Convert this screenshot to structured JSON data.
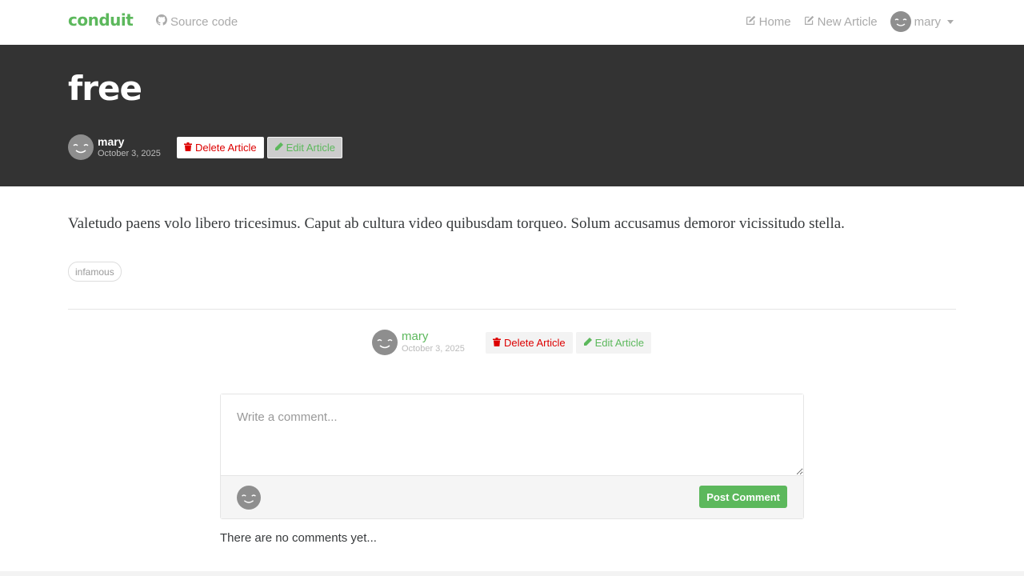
{
  "navbar": {
    "brand": "conduit",
    "source_code": "Source code",
    "home": "Home",
    "new_article": "New Article",
    "username": "mary"
  },
  "article": {
    "title": "free",
    "author": "mary",
    "date": "October 3, 2025",
    "body": "Valetudo paens volo libero tricesimus. Caput ab cultura video quibusdam torqueo. Solum accusamus demoror vicissitudo stella.",
    "tags": [
      "infamous"
    ],
    "delete_label": "Delete Article",
    "edit_label": "Edit Article"
  },
  "comments": {
    "placeholder": "Write a comment...",
    "post_label": "Post Comment",
    "empty_text": "There are no comments yet..."
  },
  "colors": {
    "brand": "#5cb85c",
    "banner": "#333333",
    "danger": "#b85c5c"
  },
  "icons": {
    "source": "github-icon",
    "home": "edit-icon",
    "new_article": "edit-icon",
    "delete": "trash-icon",
    "edit": "pencil-icon",
    "avatar": "smiley-avatar",
    "caret": "chevron-down-icon"
  }
}
